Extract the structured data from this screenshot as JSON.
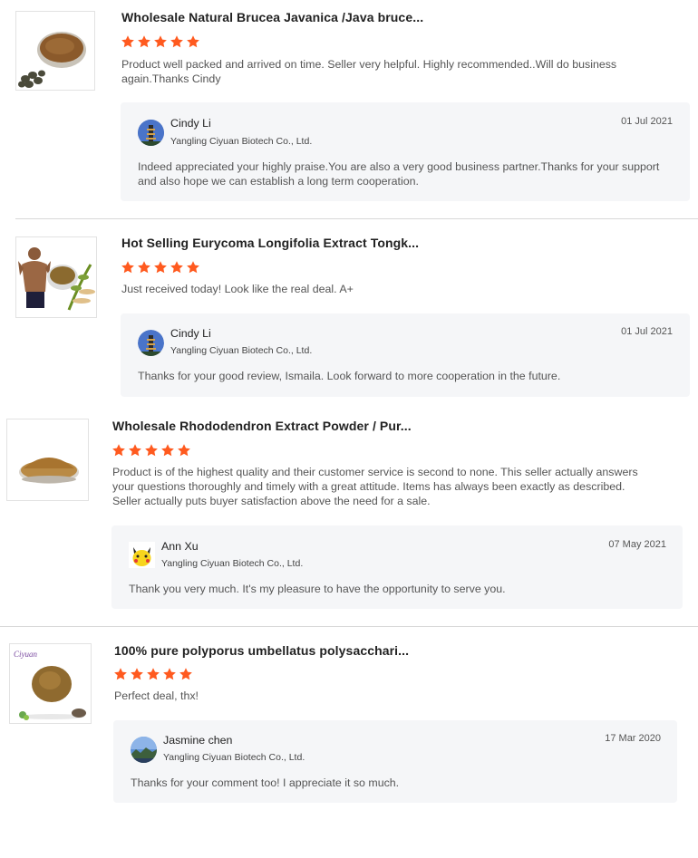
{
  "reviews": [
    {
      "title": "Wholesale Natural Brucea Javanica /Java bruce...",
      "rating": 5,
      "comment": "Product well packed and arrived on time. Seller very helpful. Highly recommended..Will do business again.Thanks Cindy",
      "product_image": "brown-powder-bowl-with-seeds",
      "reply": {
        "name": "Cindy Li",
        "company": "Yangling Ciyuan Biotech Co., Ltd.",
        "date": "01 Jul 2021",
        "text": "Indeed appreciated your highly praise.You are also a very good business partner.Thanks for your support and also hope we can establish a long term cooperation.",
        "avatar": "pagoda-avatar"
      }
    },
    {
      "title": "Hot Selling Eurycoma Longifolia Extract Tongk...",
      "rating": 5,
      "comment": "Just received today! Look like the real deal. A+",
      "product_image": "muscle-man-with-powder",
      "reply": {
        "name": "Cindy Li",
        "company": "Yangling Ciyuan Biotech Co., Ltd.",
        "date": "01 Jul 2021",
        "text": "Thanks for your good review, Ismaila. Look forward to more cooperation in the future.",
        "avatar": "pagoda-avatar"
      }
    },
    {
      "title": "Wholesale Rhododendron Extract Powder / Pur...",
      "rating": 5,
      "comment": "Product is of the highest quality and their customer service is second to none. This seller actually answers your questions thoroughly and timely with a great attitude. Items has always been exactly as described. Seller actually puts buyer satisfaction above the need for a sale.",
      "product_image": "powder-dish",
      "reply": {
        "name": "Ann Xu",
        "company": "Yangling Ciyuan Biotech Co., Ltd.",
        "date": "07 May 2021",
        "text": "Thank you very much. It's my pleasure to have the opportunity to serve you.",
        "avatar": "pikachu-avatar"
      }
    },
    {
      "title": "100% pure polyporus umbellatus polysacchari...",
      "rating": 5,
      "comment": "Perfect deal, thx!",
      "product_image": "powder-plate-with-herbs",
      "reply": {
        "name": "Jasmine chen",
        "company": "Yangling Ciyuan Biotech Co., Ltd.",
        "date": "17 Mar 2020",
        "text": "Thanks for your comment too! I appreciate it so much.",
        "avatar": "landscape-avatar"
      }
    }
  ],
  "colors": {
    "star": "#ff5a1f",
    "reply_bg": "#f5f6f8",
    "divider": "#d8d8d8"
  }
}
